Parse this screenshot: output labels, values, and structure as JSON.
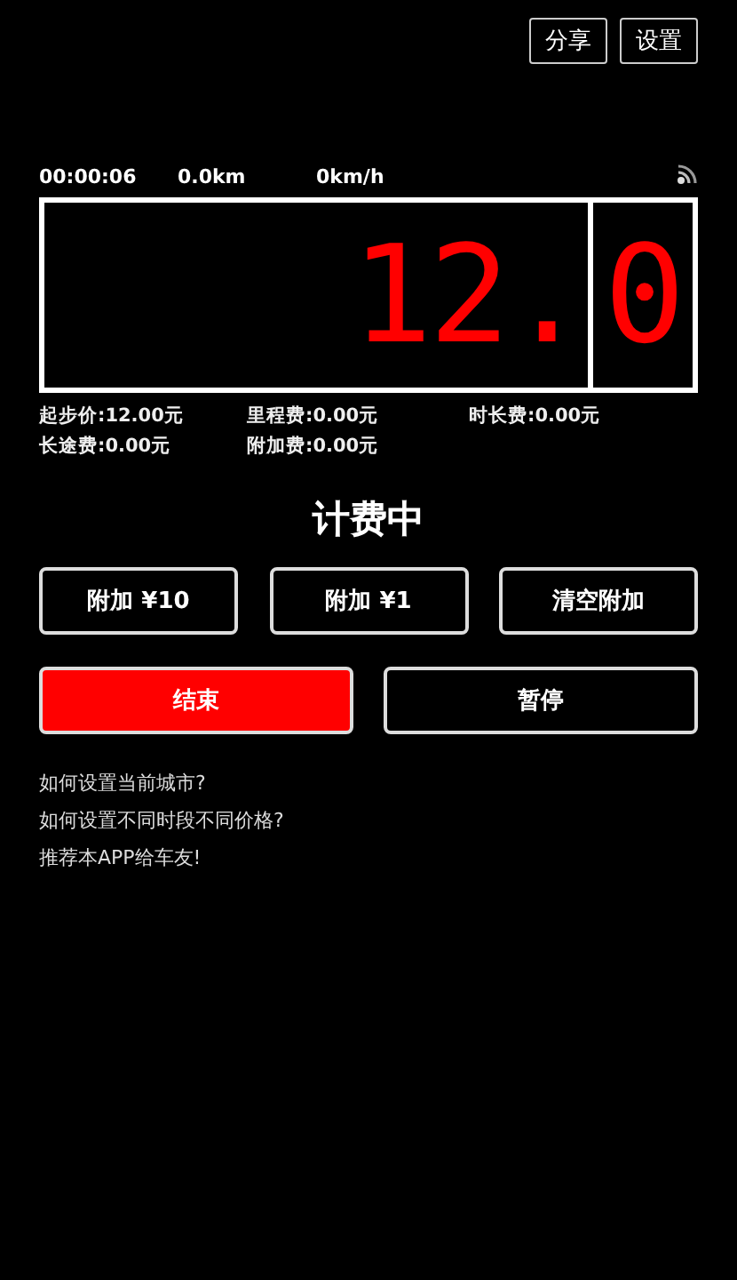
{
  "top_buttons": [
    {
      "label": "分享"
    },
    {
      "label": "设置"
    }
  ],
  "stats": [
    {
      "text": "00:00:06"
    },
    {
      "text": "0.0km"
    },
    {
      "text": "0km/h"
    }
  ],
  "meter": {
    "integer_part": "12.",
    "decimal_part": "0"
  },
  "fees": [
    {
      "text": "起步价:12.00元"
    },
    {
      "text": "里程费:0.00元"
    },
    {
      "text": "时长费:0.00元"
    },
    {
      "text": "长途费:0.00元"
    },
    {
      "text": "附加费:0.00元"
    }
  ],
  "status": "计费中",
  "surcharge_buttons": [
    {
      "label": "附加 ¥10"
    },
    {
      "label": "附加 ¥1"
    },
    {
      "label": "清空附加"
    }
  ],
  "action_buttons": [
    {
      "label": "结束",
      "kind": "filled"
    },
    {
      "label": "暂停",
      "kind": "outline"
    }
  ],
  "help_links": [
    {
      "text": "如何设置当前城市?"
    },
    {
      "text": "如何设置不同时段不同价格?"
    },
    {
      "text": "推荐本APP给车友!"
    }
  ]
}
